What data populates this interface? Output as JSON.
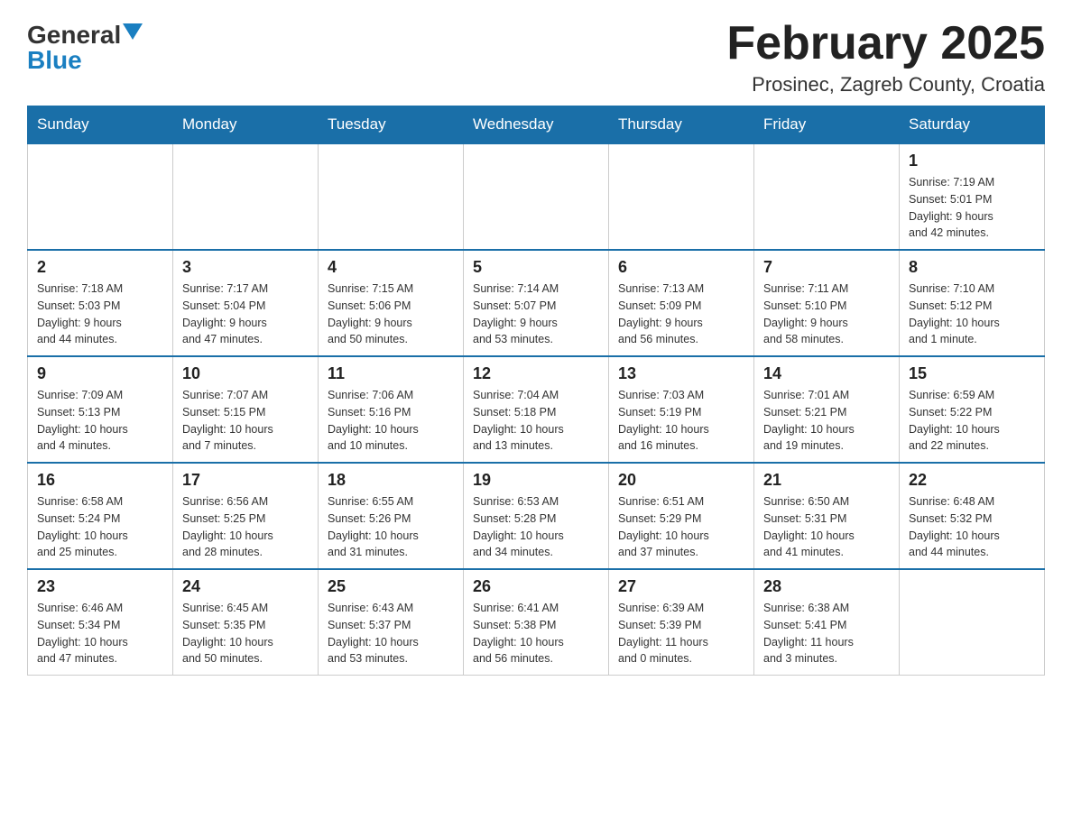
{
  "logo": {
    "general": "General",
    "blue": "Blue",
    "arrow": "▼"
  },
  "title": "February 2025",
  "subtitle": "Prosinec, Zagreb County, Croatia",
  "weekdays": [
    "Sunday",
    "Monday",
    "Tuesday",
    "Wednesday",
    "Thursday",
    "Friday",
    "Saturday"
  ],
  "weeks": [
    [
      {
        "day": "",
        "info": ""
      },
      {
        "day": "",
        "info": ""
      },
      {
        "day": "",
        "info": ""
      },
      {
        "day": "",
        "info": ""
      },
      {
        "day": "",
        "info": ""
      },
      {
        "day": "",
        "info": ""
      },
      {
        "day": "1",
        "info": "Sunrise: 7:19 AM\nSunset: 5:01 PM\nDaylight: 9 hours\nand 42 minutes."
      }
    ],
    [
      {
        "day": "2",
        "info": "Sunrise: 7:18 AM\nSunset: 5:03 PM\nDaylight: 9 hours\nand 44 minutes."
      },
      {
        "day": "3",
        "info": "Sunrise: 7:17 AM\nSunset: 5:04 PM\nDaylight: 9 hours\nand 47 minutes."
      },
      {
        "day": "4",
        "info": "Sunrise: 7:15 AM\nSunset: 5:06 PM\nDaylight: 9 hours\nand 50 minutes."
      },
      {
        "day": "5",
        "info": "Sunrise: 7:14 AM\nSunset: 5:07 PM\nDaylight: 9 hours\nand 53 minutes."
      },
      {
        "day": "6",
        "info": "Sunrise: 7:13 AM\nSunset: 5:09 PM\nDaylight: 9 hours\nand 56 minutes."
      },
      {
        "day": "7",
        "info": "Sunrise: 7:11 AM\nSunset: 5:10 PM\nDaylight: 9 hours\nand 58 minutes."
      },
      {
        "day": "8",
        "info": "Sunrise: 7:10 AM\nSunset: 5:12 PM\nDaylight: 10 hours\nand 1 minute."
      }
    ],
    [
      {
        "day": "9",
        "info": "Sunrise: 7:09 AM\nSunset: 5:13 PM\nDaylight: 10 hours\nand 4 minutes."
      },
      {
        "day": "10",
        "info": "Sunrise: 7:07 AM\nSunset: 5:15 PM\nDaylight: 10 hours\nand 7 minutes."
      },
      {
        "day": "11",
        "info": "Sunrise: 7:06 AM\nSunset: 5:16 PM\nDaylight: 10 hours\nand 10 minutes."
      },
      {
        "day": "12",
        "info": "Sunrise: 7:04 AM\nSunset: 5:18 PM\nDaylight: 10 hours\nand 13 minutes."
      },
      {
        "day": "13",
        "info": "Sunrise: 7:03 AM\nSunset: 5:19 PM\nDaylight: 10 hours\nand 16 minutes."
      },
      {
        "day": "14",
        "info": "Sunrise: 7:01 AM\nSunset: 5:21 PM\nDaylight: 10 hours\nand 19 minutes."
      },
      {
        "day": "15",
        "info": "Sunrise: 6:59 AM\nSunset: 5:22 PM\nDaylight: 10 hours\nand 22 minutes."
      }
    ],
    [
      {
        "day": "16",
        "info": "Sunrise: 6:58 AM\nSunset: 5:24 PM\nDaylight: 10 hours\nand 25 minutes."
      },
      {
        "day": "17",
        "info": "Sunrise: 6:56 AM\nSunset: 5:25 PM\nDaylight: 10 hours\nand 28 minutes."
      },
      {
        "day": "18",
        "info": "Sunrise: 6:55 AM\nSunset: 5:26 PM\nDaylight: 10 hours\nand 31 minutes."
      },
      {
        "day": "19",
        "info": "Sunrise: 6:53 AM\nSunset: 5:28 PM\nDaylight: 10 hours\nand 34 minutes."
      },
      {
        "day": "20",
        "info": "Sunrise: 6:51 AM\nSunset: 5:29 PM\nDaylight: 10 hours\nand 37 minutes."
      },
      {
        "day": "21",
        "info": "Sunrise: 6:50 AM\nSunset: 5:31 PM\nDaylight: 10 hours\nand 41 minutes."
      },
      {
        "day": "22",
        "info": "Sunrise: 6:48 AM\nSunset: 5:32 PM\nDaylight: 10 hours\nand 44 minutes."
      }
    ],
    [
      {
        "day": "23",
        "info": "Sunrise: 6:46 AM\nSunset: 5:34 PM\nDaylight: 10 hours\nand 47 minutes."
      },
      {
        "day": "24",
        "info": "Sunrise: 6:45 AM\nSunset: 5:35 PM\nDaylight: 10 hours\nand 50 minutes."
      },
      {
        "day": "25",
        "info": "Sunrise: 6:43 AM\nSunset: 5:37 PM\nDaylight: 10 hours\nand 53 minutes."
      },
      {
        "day": "26",
        "info": "Sunrise: 6:41 AM\nSunset: 5:38 PM\nDaylight: 10 hours\nand 56 minutes."
      },
      {
        "day": "27",
        "info": "Sunrise: 6:39 AM\nSunset: 5:39 PM\nDaylight: 11 hours\nand 0 minutes."
      },
      {
        "day": "28",
        "info": "Sunrise: 6:38 AM\nSunset: 5:41 PM\nDaylight: 11 hours\nand 3 minutes."
      },
      {
        "day": "",
        "info": ""
      }
    ]
  ]
}
